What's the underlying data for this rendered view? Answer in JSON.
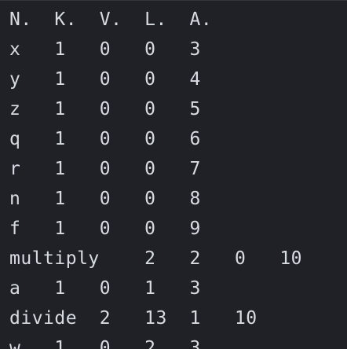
{
  "terminal": {
    "lines": [
      "N.  K.  V.  L.  A.",
      "x   1   0   0   3",
      "y   1   0   0   4",
      "z   1   0   0   5",
      "q   1   0   0   6",
      "r   1   0   0   7",
      "n   1   0   0   8",
      "f   1   0   0   9",
      "multiply    2   2   0   10",
      "a   1   0   1   3",
      "divide  2   13  1   10",
      "w   1   0   2   3"
    ]
  }
}
